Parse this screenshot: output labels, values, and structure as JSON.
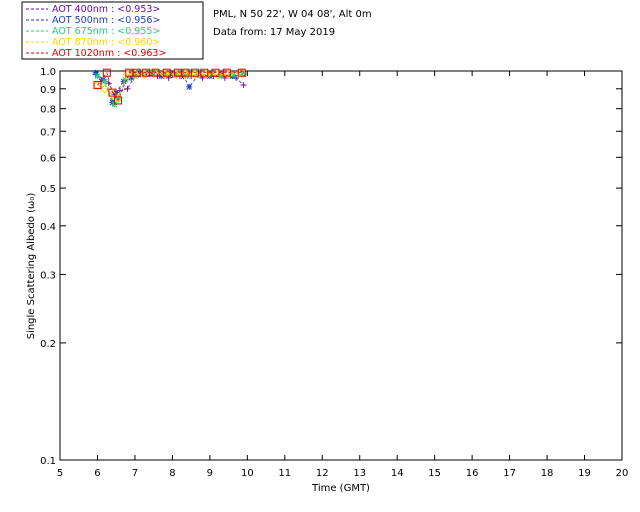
{
  "header": {
    "site": "PML, N 50 22', W 04 08', Alt 0m",
    "date": "Data from: 17 May 2019"
  },
  "legend": [
    {
      "label": "AOT  400nm : <0.953>",
      "color": "#6a0dad"
    },
    {
      "label": "AOT  500nm : <0.956>",
      "color": "#1f3fbf"
    },
    {
      "label": "AOT  675nm : <0.955>",
      "color": "#1fcf7f"
    },
    {
      "label": "AOT  870nm : <0.960>",
      "color": "#ffd200"
    },
    {
      "label": "AOT 1020nm : <0.963>",
      "color": "#e00000"
    }
  ],
  "chart_data": {
    "type": "scatter",
    "xlabel": "Time (GMT)",
    "ylabel": "Single Scattering Albedo (ω₀)",
    "xlim": [
      5,
      20
    ],
    "ylim": [
      0.1,
      1.0
    ],
    "yscale": "log",
    "xticks": [
      5,
      6,
      7,
      8,
      9,
      10,
      11,
      12,
      13,
      14,
      15,
      16,
      17,
      18,
      19,
      20
    ],
    "yticks": [
      {
        "value": 1.0,
        "label": "1.0"
      },
      {
        "value": 0.9,
        "label": "0.9"
      },
      {
        "value": 0.8,
        "label": "0.8"
      },
      {
        "value": 0.7,
        "label": "0.7"
      },
      {
        "value": 0.6,
        "label": "0.6"
      },
      {
        "value": 0.5,
        "label": "0.5"
      },
      {
        "value": 0.4,
        "label": "0.4"
      },
      {
        "value": 0.3,
        "label": "0.3"
      },
      {
        "value": 0.2,
        "label": "0.2"
      },
      {
        "value": 0.1,
        "label": "0.1"
      }
    ],
    "series": [
      {
        "name": "AOT  400nm",
        "marker": "plus",
        "color": "#6a0dad",
        "x": [
          5.95,
          6.1,
          6.3,
          6.45,
          6.6,
          6.8,
          7.0,
          7.3,
          7.6,
          7.9,
          8.2,
          8.5,
          8.8,
          9.1,
          9.4,
          9.7,
          9.9
        ],
        "y": [
          0.98,
          0.94,
          0.93,
          0.87,
          0.89,
          0.9,
          0.97,
          0.98,
          0.97,
          0.96,
          0.97,
          0.97,
          0.96,
          0.97,
          0.96,
          0.96,
          0.92
        ]
      },
      {
        "name": "AOT  500nm",
        "marker": "star",
        "color": "#1f3fbf",
        "x": [
          5.95,
          6.15,
          6.4,
          6.5,
          6.7,
          6.9,
          7.1,
          7.4,
          7.7,
          8.0,
          8.3,
          8.45,
          8.7,
          9.0,
          9.3,
          9.6,
          9.9
        ],
        "y": [
          0.99,
          0.95,
          0.83,
          0.88,
          0.94,
          0.96,
          0.98,
          0.98,
          0.97,
          0.98,
          0.97,
          0.91,
          0.98,
          0.97,
          0.98,
          0.97,
          0.98
        ]
      },
      {
        "name": "AOT  675nm",
        "marker": "star",
        "color": "#1fcf7f",
        "x": [
          6.0,
          6.2,
          6.45,
          6.55,
          6.75,
          7.0,
          7.2,
          7.5,
          7.8,
          8.1,
          8.4,
          8.7,
          9.0,
          9.3,
          9.6,
          9.9
        ],
        "y": [
          0.97,
          0.94,
          0.82,
          0.85,
          0.95,
          0.97,
          0.98,
          0.98,
          0.98,
          0.98,
          0.97,
          0.98,
          0.98,
          0.97,
          0.98,
          0.98
        ]
      },
      {
        "name": "AOT  870nm",
        "marker": "diamond",
        "color": "#ffd200",
        "x": [
          6.0,
          6.2,
          6.4,
          6.55,
          6.8,
          7.0,
          7.25,
          7.5,
          7.8,
          8.1,
          8.35,
          8.6,
          8.9,
          9.2,
          9.5,
          9.85
        ],
        "y": [
          0.92,
          0.9,
          0.87,
          0.85,
          0.98,
          0.98,
          0.98,
          0.99,
          0.98,
          0.98,
          0.98,
          0.98,
          0.98,
          0.98,
          0.98,
          0.99
        ]
      },
      {
        "name": "AOT 1020nm",
        "marker": "square",
        "color": "#e00000",
        "x": [
          6.0,
          6.25,
          6.4,
          6.55,
          6.85,
          7.05,
          7.3,
          7.55,
          7.85,
          8.15,
          8.35,
          8.6,
          8.85,
          9.15,
          9.45,
          9.85
        ],
        "y": [
          0.92,
          0.99,
          0.88,
          0.84,
          0.99,
          0.99,
          0.99,
          0.99,
          0.99,
          0.99,
          0.99,
          0.99,
          0.99,
          0.99,
          0.99,
          0.99
        ]
      }
    ]
  }
}
